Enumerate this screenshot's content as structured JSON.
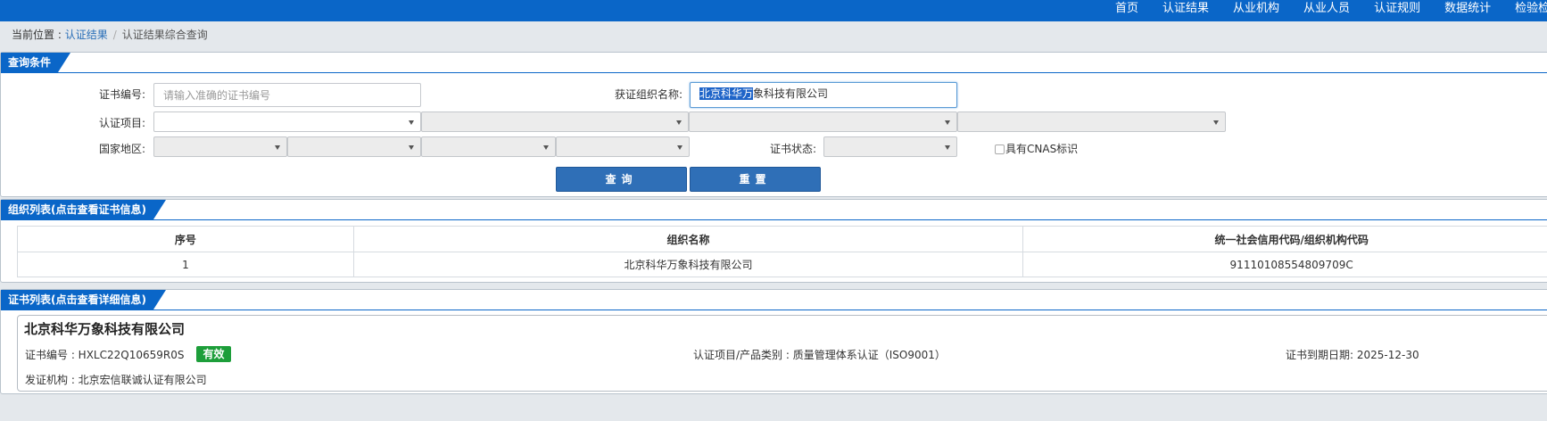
{
  "topnav": [
    "首页",
    "认证结果",
    "从业机构",
    "从业人员",
    "认证规则",
    "数据统计",
    "检验检"
  ],
  "breadcrumb": {
    "label": "当前位置 : ",
    "link": "认证结果",
    "sep": "/",
    "current": "认证结果综合查询"
  },
  "query_panel": {
    "title": "查询条件",
    "cert_no_label": "证书编号:",
    "cert_no_placeholder": "请输入准确的证书编号",
    "org_name_label": "获证组织名称:",
    "org_name_selected": "北京科华万",
    "org_name_rest": "象科技有限公司",
    "project_label": "认证项目:",
    "region_label": "国家地区:",
    "status_label": "证书状态:",
    "cnas_label": "具有CNAS标识",
    "query_button": "查询",
    "reset_button": "重置"
  },
  "org_panel": {
    "title": "组织列表(点击查看证书信息)",
    "columns": [
      "序号",
      "组织名称",
      "统一社会信用代码/组织机构代码"
    ],
    "rows": [
      [
        "1",
        "北京科华万象科技有限公司",
        "91110108554809709C"
      ]
    ]
  },
  "cert_panel": {
    "title": "证书列表(点击查看详细信息)",
    "org_name": "北京科华万象科技有限公司",
    "cert_no": "证书编号 : HXLC22Q10659R0S",
    "status": "有效",
    "category": "认证项目/产品类别 : 质量管理体系认证（ISO9001）",
    "expiry": "证书到期日期: 2025-12-30",
    "issuer": "发证机构 : 北京宏信联诚认证有限公司"
  },
  "colors": {
    "primary": "#0a66c8",
    "button": "#2f6fb7",
    "valid": "#1d9e3a"
  }
}
